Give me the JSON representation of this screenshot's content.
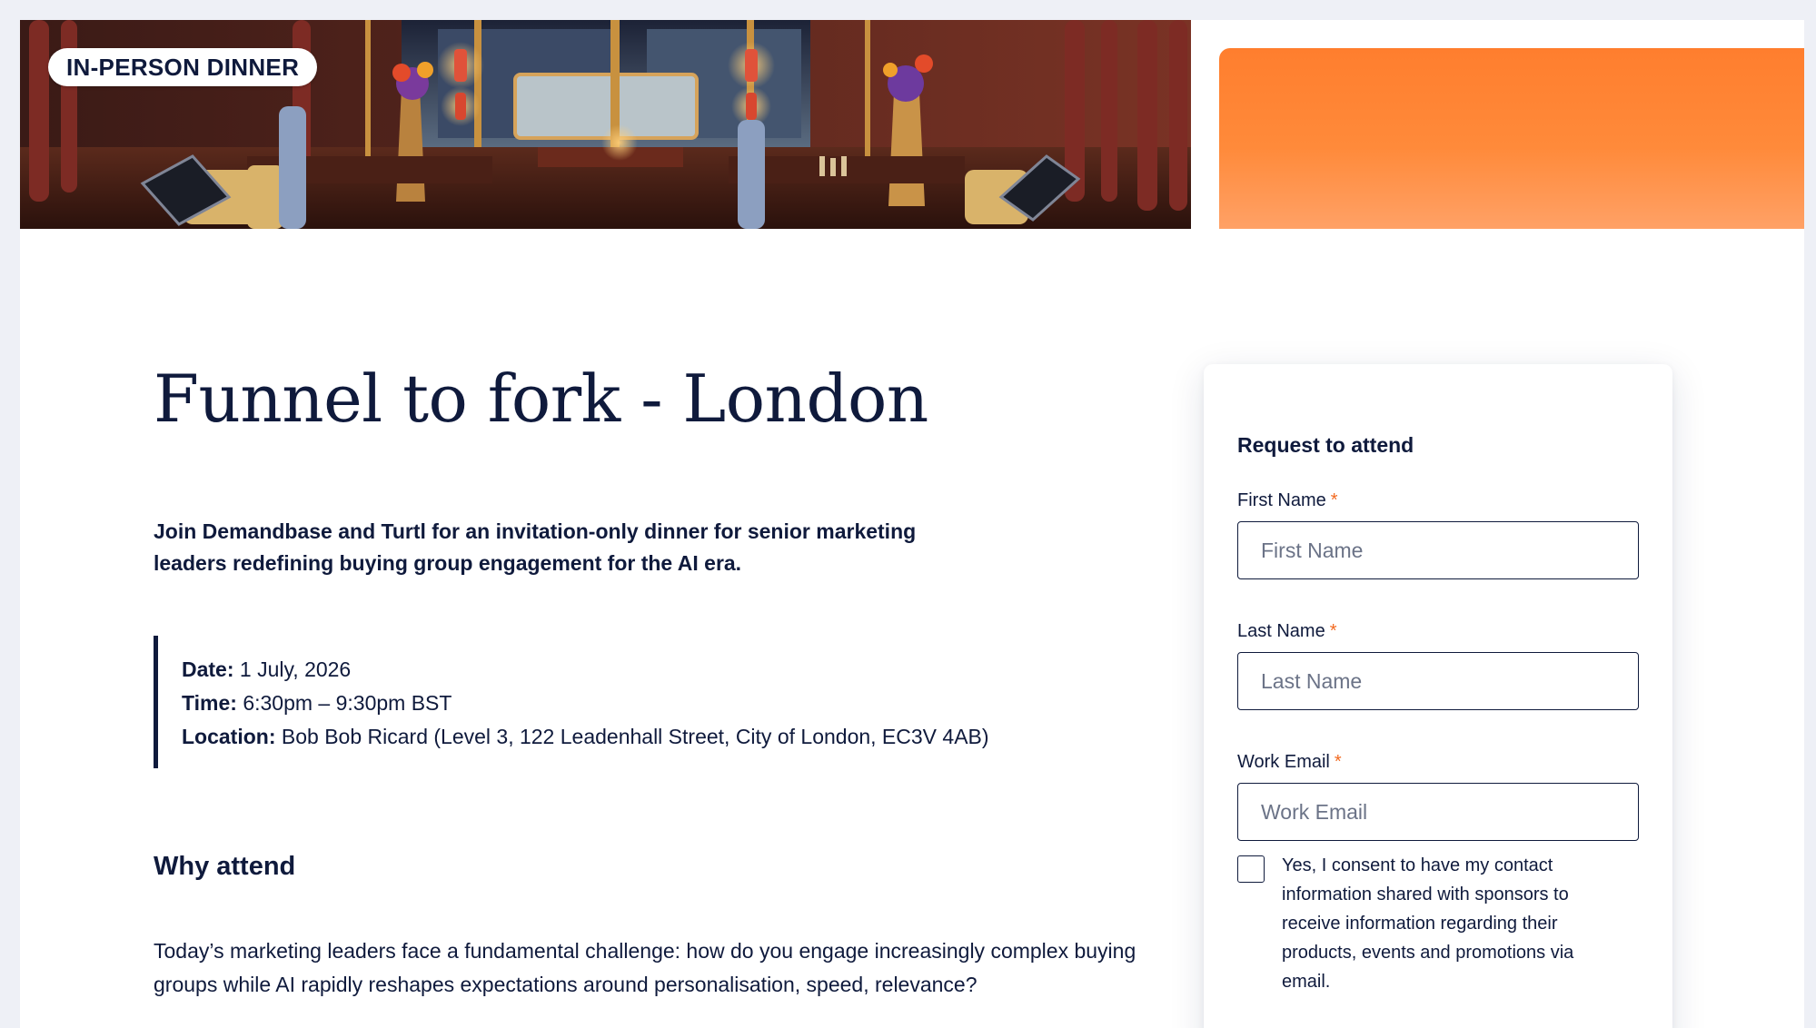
{
  "hero": {
    "badge": "IN-PERSON DINNER"
  },
  "event": {
    "title": "Funnel to fork - London",
    "intro": "Join Demandbase and Turtl for an invitation-only dinner for senior marketing leaders redefining buying group engagement for the AI era.",
    "date_label": "Date:",
    "date_value": "1 July, 2026",
    "time_label": "Time:",
    "time_value": "6:30pm – 9:30pm BST",
    "location_label": "Location:",
    "location_value": "Bob Bob Ricard (Level 3, 122 Leadenhall Street, City of London, EC3V 4AB)"
  },
  "why": {
    "heading": "Why attend",
    "body": "Today’s marketing leaders face a fundamental challenge: how do you engage increasingly complex buying groups while AI rapidly reshapes expectations around personalisation, speed, relevance?"
  },
  "form": {
    "title": "Request to attend",
    "required_marker": "*",
    "first_name": {
      "label": "First Name",
      "placeholder": "First Name",
      "value": ""
    },
    "last_name": {
      "label": "Last Name",
      "placeholder": "Last Name",
      "value": ""
    },
    "work_email": {
      "label": "Work Email",
      "placeholder": "Work Email",
      "value": ""
    },
    "consent": {
      "checked": false,
      "text": "Yes, I consent to have my contact information shared with sponsors to receive information regarding their products, events and promotions via email."
    }
  },
  "colors": {
    "navy": "#0f1a3c",
    "accent_orange": "#ff7e2e",
    "required": "#f26a21",
    "page_bg": "#eef0f6"
  }
}
